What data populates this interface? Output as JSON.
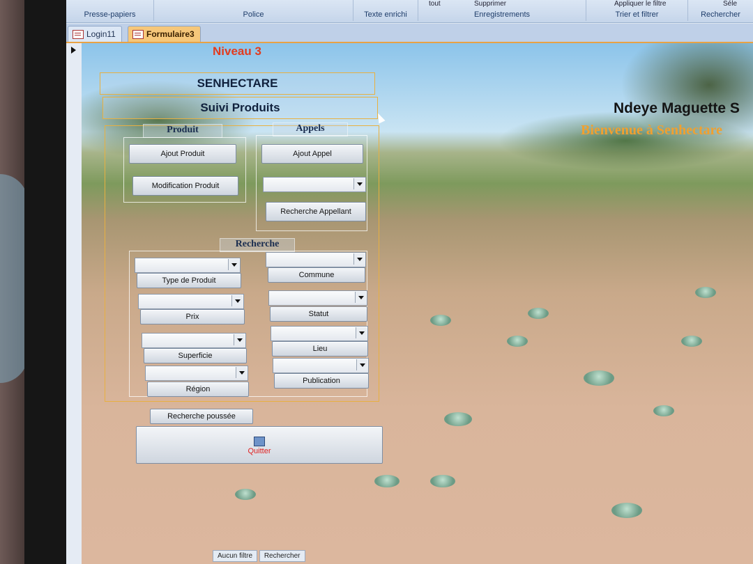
{
  "ribbon": {
    "groups": [
      "Presse-papiers",
      "Police",
      "Texte enrichi",
      "Enregistrements",
      "Trier et filtrer",
      "Rechercher"
    ],
    "top_items": [
      "tout",
      "Supprimer",
      "Appliquer le filtre",
      "Séle"
    ]
  },
  "tabs": [
    {
      "label": "Login11",
      "active": false
    },
    {
      "label": "Formulaire3",
      "active": true
    }
  ],
  "form": {
    "level": "Niveau 3",
    "app_name": "SENHECTARE",
    "subtitle": "Suivi Produits",
    "user_name": "Ndeye Maguette S",
    "welcome": "Bienvenue à Senhectare",
    "produit": {
      "label": "Produit",
      "add_button": "Ajout Produit",
      "edit_button": "Modification Produit"
    },
    "appels": {
      "label": "Appels",
      "add_button": "Ajout Appel",
      "combo_value": "",
      "search_button": "Recherche  Appellant"
    },
    "recherche": {
      "label": "Recherche",
      "left_buttons": [
        "Type de Produit",
        "Prix",
        "Superficie",
        "Région"
      ],
      "right_buttons": [
        "Commune",
        "Statut",
        "Lieu",
        "Publication"
      ],
      "advanced_button": "Recherche poussée"
    },
    "quit_button": "Quitter"
  },
  "status_bar": {
    "items": [
      "Aucun filtre",
      "Rechercher"
    ]
  },
  "colors": {
    "level_text": "#e23b1e",
    "welcome_text": "#f0a030",
    "active_tab": "#f6c77a",
    "box_border": "#e8b040"
  }
}
